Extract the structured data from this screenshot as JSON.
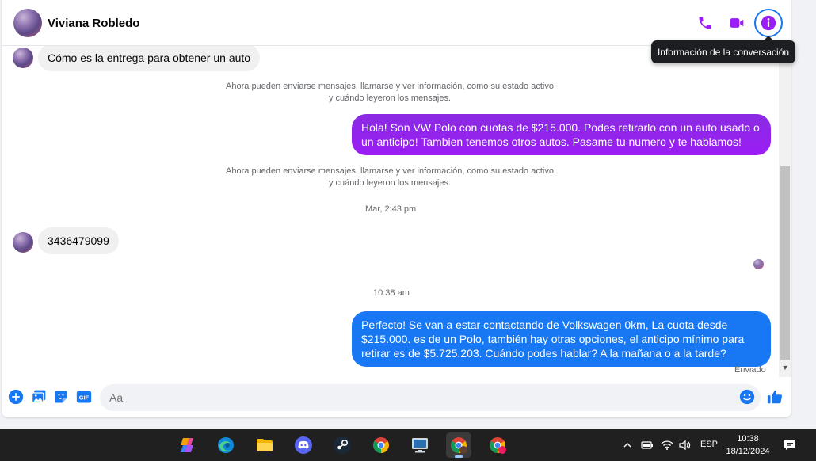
{
  "header": {
    "contact_name": "Viviana Robledo",
    "tooltip": "Información de la conversación"
  },
  "messages": {
    "incoming_1": "Cómo es la entrega para obtener un auto",
    "system_1_line1": "Ahora pueden enviarse mensajes, llamarse y ver información, como su estado activo",
    "system_1_line2": "y cuándo leyeron los mensajes.",
    "outgoing_1": "Hola! Son VW Polo con cuotas de $215.000. Podes retirarlo con un auto usado o un anticipo! Tambien tenemos otros autos. Pasame tu numero y te hablamos!",
    "system_2_line1": "Ahora pueden enviarse mensajes, llamarse y ver información, como su estado activo",
    "system_2_line2": "y cuándo leyeron los mensajes.",
    "timestamp_1": "Mar, 2:43 pm",
    "incoming_2": "3436479099",
    "timestamp_2": "10:38 am",
    "outgoing_2": "Perfecto!  Se van a estar contactando de Volkswagen 0km, La cuota desde $215.000. es de un Polo, también hay otras opciones, el anticipo mínimo para retirar es de $5.725.203. Cuándo podes hablar? A la mañana o a la tarde?",
    "sent_status": "Enviado"
  },
  "composer": {
    "placeholder": "Aa"
  },
  "taskbar": {
    "language": "ESP",
    "time": "10:38",
    "date": "18/12/2024",
    "apps": [
      "copilot-icon",
      "edge-icon",
      "file-explorer-icon",
      "discord-icon",
      "steam-icon",
      "chrome-icon",
      "remote-desktop-icon",
      "chrome-profile-icon",
      "chrome-profile-icon"
    ]
  },
  "colors": {
    "accent_purple": "#9b1df5",
    "outgoing_gradient_top": "#8a2be2",
    "outgoing_blue": "#0a7cff",
    "messenger_blue": "#1877f2"
  }
}
